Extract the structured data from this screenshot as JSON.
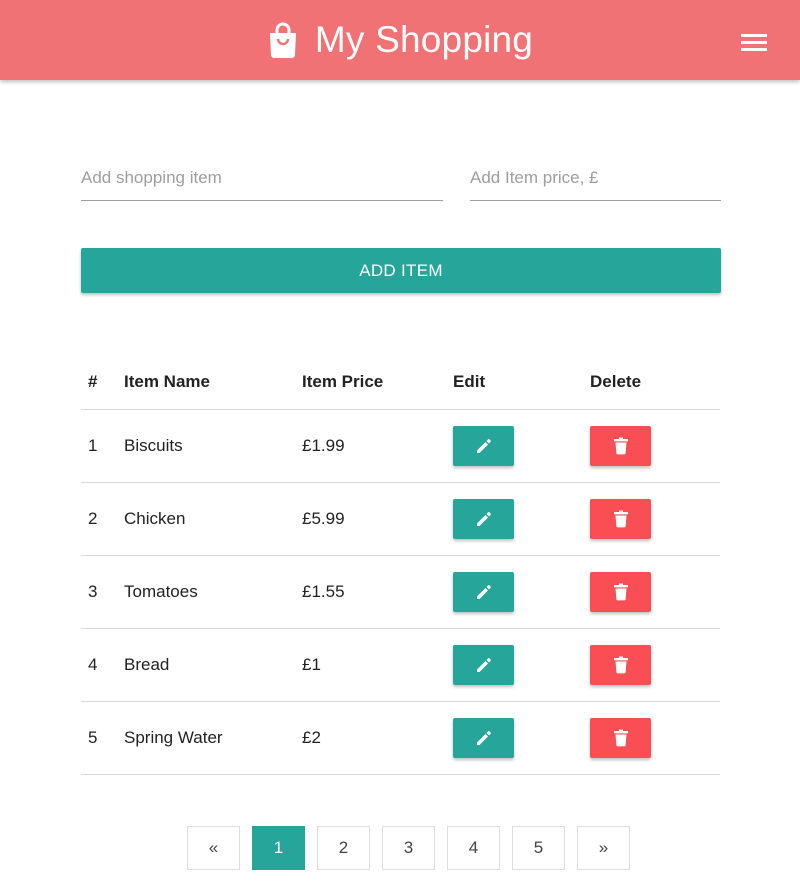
{
  "header": {
    "title": "My Shopping",
    "brand_icon": "shopping-bag-icon",
    "menu_icon": "hamburger-menu-icon",
    "color": "#f07275"
  },
  "form": {
    "item_placeholder": "Add shopping item",
    "price_placeholder": "Add Item price, £",
    "item_value": "",
    "price_value": "",
    "add_label": "ADD ITEM",
    "accent": "#26a69a"
  },
  "table": {
    "headers": [
      "#",
      "Item Name",
      "Item Price",
      "Edit",
      "Delete"
    ],
    "rows": [
      {
        "num": "1",
        "name": "Biscuits",
        "price": "£1.99"
      },
      {
        "num": "2",
        "name": "Chicken",
        "price": "£5.99"
      },
      {
        "num": "3",
        "name": "Tomatoes",
        "price": "£1.55"
      },
      {
        "num": "4",
        "name": "Bread",
        "price": "£1"
      },
      {
        "num": "5",
        "name": "Spring Water",
        "price": "£2"
      }
    ],
    "edit_icon": "pencil-icon",
    "delete_icon": "trash-icon",
    "delete_color": "#f94f54"
  },
  "pagination": {
    "prev": "«",
    "pages": [
      "1",
      "2",
      "3",
      "4",
      "5"
    ],
    "next": "»",
    "active": "1"
  }
}
